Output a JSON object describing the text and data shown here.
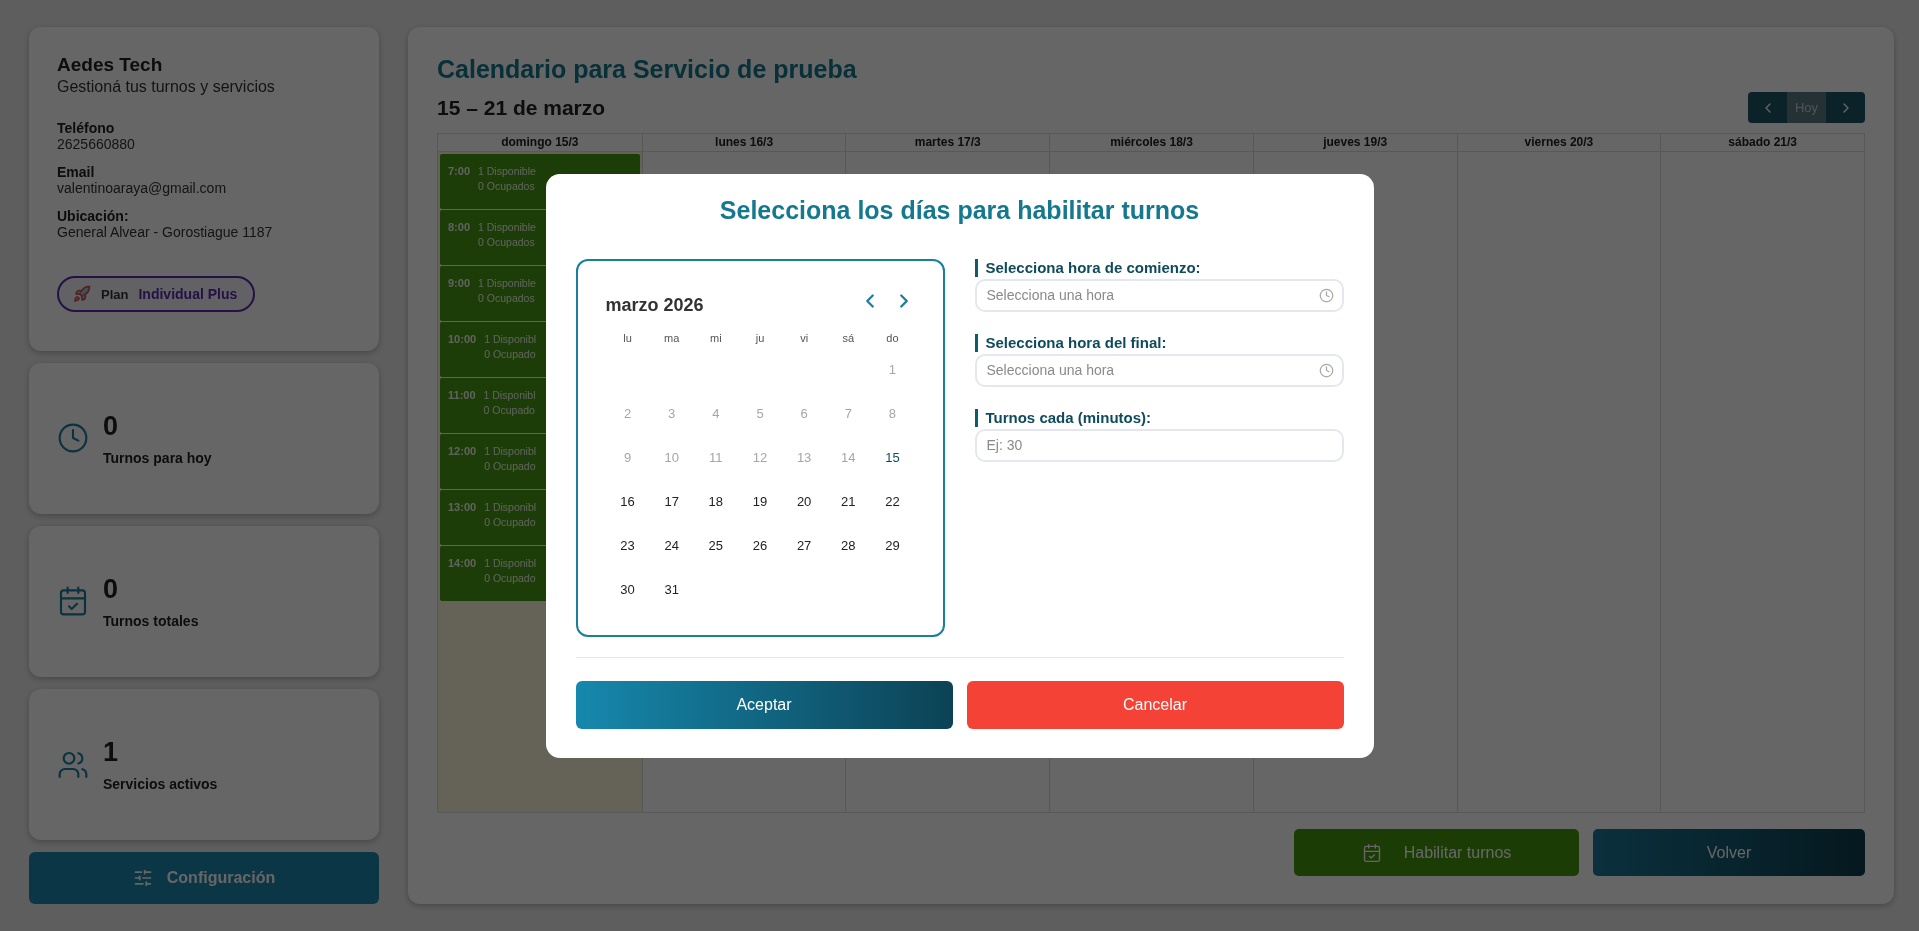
{
  "profile": {
    "name": "Aedes Tech",
    "tagline": "Gestioná tus turnos y servicios",
    "fields": [
      {
        "label": "Teléfono",
        "value": "2625660880"
      },
      {
        "label": "Email",
        "value": "valentinoaraya@gmail.com"
      },
      {
        "label": "Ubicación:",
        "value": "General Alvear - Gorostiague 1187"
      }
    ],
    "plan": {
      "label": "Plan",
      "value": "Individual Plus"
    }
  },
  "stats": [
    {
      "kind": "clock",
      "value": "0",
      "label": "Turnos para hoy"
    },
    {
      "kind": "calendar",
      "value": "0",
      "label": "Turnos totales"
    },
    {
      "kind": "users",
      "value": "1",
      "label": "Servicios activos"
    }
  ],
  "config_button": "Configuración",
  "calendar": {
    "title": "Calendario para Servicio de prueba",
    "range": "15 – 21 de marzo",
    "nav": [
      {
        "kind": "prev",
        "disabled": false
      },
      {
        "kind": "today",
        "label": "Hoy",
        "disabled": true
      },
      {
        "kind": "next",
        "disabled": false
      }
    ],
    "columns": [
      {
        "label": "domingo 15/3",
        "today": true,
        "slots": [
          {
            "time": "7:00",
            "available": "1 Disponible",
            "busy": "0 Ocupados"
          },
          {
            "time": "8:00",
            "available": "1 Disponible",
            "busy": "0 Ocupados"
          },
          {
            "time": "9:00",
            "available": "1 Disponible",
            "busy": "0 Ocupados"
          },
          {
            "time": "10:00",
            "available": "1 Disponibl",
            "busy": "0 Ocupado"
          },
          {
            "time": "11:00",
            "available": "1 Disponibl",
            "busy": "0 Ocupado"
          },
          {
            "time": "12:00",
            "available": "1 Disponibl",
            "busy": "0 Ocupado"
          },
          {
            "time": "13:00",
            "available": "1 Disponibl",
            "busy": "0 Ocupado"
          },
          {
            "time": "14:00",
            "available": "1 Disponibl",
            "busy": "0 Ocupado"
          }
        ]
      },
      {
        "label": "lunes 16/3",
        "today": false
      },
      {
        "label": "martes 17/3",
        "today": false
      },
      {
        "label": "miércoles 18/3",
        "today": false
      },
      {
        "label": "jueves 19/3",
        "today": false
      },
      {
        "label": "viernes 20/3",
        "today": false
      },
      {
        "label": "sábado 21/3",
        "today": false
      }
    ],
    "actions": [
      {
        "kind": "enable",
        "label": "Habilitar turnos"
      },
      {
        "kind": "back",
        "label": "Volver"
      }
    ]
  },
  "modal": {
    "title": "Selecciona los días para habilitar turnos",
    "picker": {
      "month": "marzo 2026",
      "weekdays": [
        "lu",
        "ma",
        "mi",
        "ju",
        "vi",
        "sá",
        "do"
      ],
      "weeks": [
        [
          {
            "kind": "blank"
          },
          {
            "kind": "blank"
          },
          {
            "kind": "blank"
          },
          {
            "kind": "blank"
          },
          {
            "kind": "blank"
          },
          {
            "kind": "blank"
          },
          {
            "kind": "day",
            "day": "1",
            "disabled": true,
            "today": false
          }
        ],
        [
          {
            "kind": "day",
            "day": "2",
            "disabled": true,
            "today": false
          },
          {
            "kind": "day",
            "day": "3",
            "disabled": true,
            "today": false
          },
          {
            "kind": "day",
            "day": "4",
            "disabled": true,
            "today": false
          },
          {
            "kind": "day",
            "day": "5",
            "disabled": true,
            "today": false
          },
          {
            "kind": "day",
            "day": "6",
            "disabled": true,
            "today": false
          },
          {
            "kind": "day",
            "day": "7",
            "disabled": true,
            "today": false
          },
          {
            "kind": "day",
            "day": "8",
            "disabled": true,
            "today": false
          }
        ],
        [
          {
            "kind": "day",
            "day": "9",
            "disabled": true,
            "today": false
          },
          {
            "kind": "day",
            "day": "10",
            "disabled": true,
            "today": false
          },
          {
            "kind": "day",
            "day": "11",
            "disabled": true,
            "today": false
          },
          {
            "kind": "day",
            "day": "12",
            "disabled": true,
            "today": false
          },
          {
            "kind": "day",
            "day": "13",
            "disabled": true,
            "today": false
          },
          {
            "kind": "day",
            "day": "14",
            "disabled": true,
            "today": false
          },
          {
            "kind": "day",
            "day": "15",
            "disabled": false,
            "today": true
          }
        ],
        [
          {
            "kind": "day",
            "day": "16",
            "disabled": false,
            "today": false
          },
          {
            "kind": "day",
            "day": "17",
            "disabled": false,
            "today": false
          },
          {
            "kind": "day",
            "day": "18",
            "disabled": false,
            "today": false
          },
          {
            "kind": "day",
            "day": "19",
            "disabled": false,
            "today": false
          },
          {
            "kind": "day",
            "day": "20",
            "disabled": false,
            "today": false
          },
          {
            "kind": "day",
            "day": "21",
            "disabled": false,
            "today": false
          },
          {
            "kind": "day",
            "day": "22",
            "disabled": false,
            "today": false
          }
        ],
        [
          {
            "kind": "day",
            "day": "23",
            "disabled": false,
            "today": false
          },
          {
            "kind": "day",
            "day": "24",
            "disabled": false,
            "today": false
          },
          {
            "kind": "day",
            "day": "25",
            "disabled": false,
            "today": false
          },
          {
            "kind": "day",
            "day": "26",
            "disabled": false,
            "today": false
          },
          {
            "kind": "day",
            "day": "27",
            "disabled": false,
            "today": false
          },
          {
            "kind": "day",
            "day": "28",
            "disabled": false,
            "today": false
          },
          {
            "kind": "day",
            "day": "29",
            "disabled": false,
            "today": false
          }
        ],
        [
          {
            "kind": "day",
            "day": "30",
            "disabled": false,
            "today": false
          },
          {
            "kind": "day",
            "day": "31",
            "disabled": false,
            "today": false
          }
        ]
      ]
    },
    "fields": [
      {
        "kind": "time",
        "label": "Selecciona hora de comienzo:",
        "placeholder": "Selecciona una hora"
      },
      {
        "kind": "time",
        "label": "Selecciona hora del final:",
        "placeholder": "Selecciona una hora"
      },
      {
        "kind": "number",
        "label": "Turnos cada (minutos):",
        "placeholder": "Ej: 30"
      }
    ],
    "buttons": [
      {
        "kind": "accept",
        "label": "Aceptar"
      },
      {
        "kind": "cancel",
        "label": "Cancelar"
      }
    ]
  }
}
